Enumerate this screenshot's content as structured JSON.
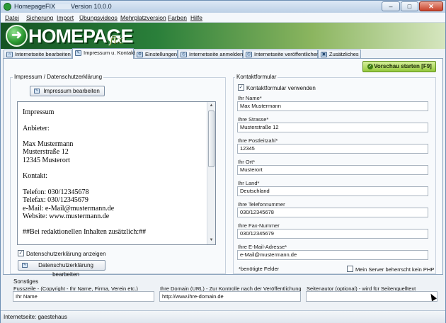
{
  "window": {
    "title_prefix": "HomepageFIX",
    "title_version": "Version 10.0.0"
  },
  "window_controls": {
    "minimize": "–",
    "maximize": "□",
    "close": "✕"
  },
  "menu": [
    "Datei",
    "Sicherung",
    "Import",
    "Übungsvideos",
    "Mehrplatzversion",
    "Farben",
    "Hilfe"
  ],
  "banner": {
    "logo_text": "HOMEPAGE",
    "logo_script": "fix"
  },
  "tabs": [
    {
      "label": "Internetseite bearbeiten",
      "icon": "home-icon",
      "glyph": "⌂"
    },
    {
      "label": "Impressum u. Kontakt",
      "icon": "edit-icon",
      "glyph": "✎"
    },
    {
      "label": "Einstellungen",
      "icon": "settings-icon",
      "glyph": "⚙"
    },
    {
      "label": "Internetseite anmelden",
      "icon": "globe-icon",
      "glyph": "◎"
    },
    {
      "label": "Internetseite veröffentlichen",
      "icon": "globe-icon",
      "glyph": "◎"
    },
    {
      "label": "Zusätzliches",
      "icon": "image-icon",
      "glyph": "▣"
    }
  ],
  "active_tab_index": 1,
  "preview_button": {
    "label": "Vorschau starten [F9]",
    "icon": "check-icon",
    "glyph": "✓",
    "color": "#94c83b"
  },
  "impressum": {
    "group_title": "Impressum / Datenschutzerklärung",
    "edit_button": "Impressum bearbeiten",
    "document_lines": [
      "Impressum",
      "",
      "Anbieter:",
      "",
      "Max Mustermann",
      "Musterstraße 12",
      "12345 Musterort",
      "",
      "Kontakt:",
      "",
      "Telefon: 030/12345678",
      "Telefax: 030/12345679",
      "e-Mail: e-Mail@mustermann.de",
      "Website: www.mustermann.de",
      "",
      "##Bei redaktionellen Inhalten zusätzlich:##"
    ],
    "privacy_checkbox_label": "Datenschutzerklärung anzeigen",
    "privacy_checked": true,
    "privacy_edit_button": "Datenschutzerklärung bearbeiten"
  },
  "contact_form": {
    "group_title": "Kontaktformular",
    "use_checkbox_label": "Kontaktformular verwenden",
    "use_checked": true,
    "fields": [
      {
        "label": "Ihr Name*",
        "value": "Max Mustermann"
      },
      {
        "label": "Ihre Strasse*",
        "value": "Musterstraße 12"
      },
      {
        "label": "Ihre Postleitzahl*",
        "value": "12345"
      },
      {
        "label": "Ihr Ort*",
        "value": "Musterort"
      },
      {
        "label": "Ihr Land*",
        "value": "Deutschland"
      },
      {
        "label": "Ihre Telefonnummer",
        "value": "030/12345678"
      },
      {
        "label": "Ihre Fax-Nummer",
        "value": "030/12345679"
      },
      {
        "label": "Ihre E-Mail-Adresse*",
        "value": "e-Mail@mustermann.de"
      }
    ],
    "required_note": "*benötigte Felder",
    "php_checkbox_label": "Mein Server beherrscht kein PHP",
    "php_checked": false
  },
  "sonstiges": {
    "group_title": "Sonstiges",
    "footer_label": "Fusszeile - (Copyright - Ihr Name, Firma, Verein etc.)",
    "footer_value": "Ihr Name",
    "domain_label": "Ihre Domain (URL) - Zur Kontrolle nach der Veröffentlichung",
    "domain_value": "http://www.ihre-domain.de",
    "author_label": "Seitenautor (optional) - wird für Seitenquelltext",
    "author_value": ""
  },
  "status": {
    "text": "Internetseite: gaestehaus"
  }
}
